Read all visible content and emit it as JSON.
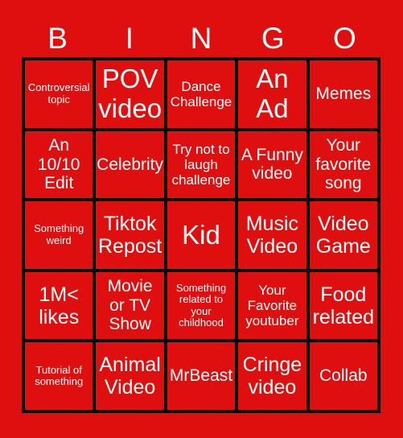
{
  "card": {
    "header_letters": [
      "B",
      "I",
      "N",
      "G",
      "O"
    ],
    "background_color": "#e00f0f",
    "border_color": "#000000",
    "text_color": "#ffffff",
    "rows": [
      [
        {
          "text": "Controversial topic",
          "size": "s-xs"
        },
        {
          "text": "POV video",
          "size": "s-xl"
        },
        {
          "text": "Dance Challenge",
          "size": "s-sm"
        },
        {
          "text": "An Ad",
          "size": "s-xl"
        },
        {
          "text": "Memes",
          "size": "s-md"
        }
      ],
      [
        {
          "text": "An 10/10 Edit",
          "size": "s-md"
        },
        {
          "text": "Celebrity",
          "size": "s-md"
        },
        {
          "text": "Try not to laugh challenge",
          "size": "s-sm"
        },
        {
          "text": "A Funny video",
          "size": "s-md"
        },
        {
          "text": "Your favorite song",
          "size": "s-md"
        }
      ],
      [
        {
          "text": "Something weird",
          "size": "s-xs"
        },
        {
          "text": "Tiktok Repost",
          "size": "s-lg"
        },
        {
          "text": "Kid",
          "size": "s-xl"
        },
        {
          "text": "Music Video",
          "size": "s-lg"
        },
        {
          "text": "Video Game",
          "size": "s-lg"
        }
      ],
      [
        {
          "text": "1M< likes",
          "size": "s-lg"
        },
        {
          "text": "Movie or TV Show",
          "size": "s-md"
        },
        {
          "text": "Something related to your childhood",
          "size": "s-xs"
        },
        {
          "text": "Your Favorite youtuber",
          "size": "s-sm"
        },
        {
          "text": "Food related",
          "size": "s-lg"
        }
      ],
      [
        {
          "text": "Tutorial of something",
          "size": "s-xs"
        },
        {
          "text": "Animal Video",
          "size": "s-lg"
        },
        {
          "text": "MrBeast",
          "size": "s-md"
        },
        {
          "text": "Cringe video",
          "size": "s-lg"
        },
        {
          "text": "Collab",
          "size": "s-md"
        }
      ]
    ]
  }
}
